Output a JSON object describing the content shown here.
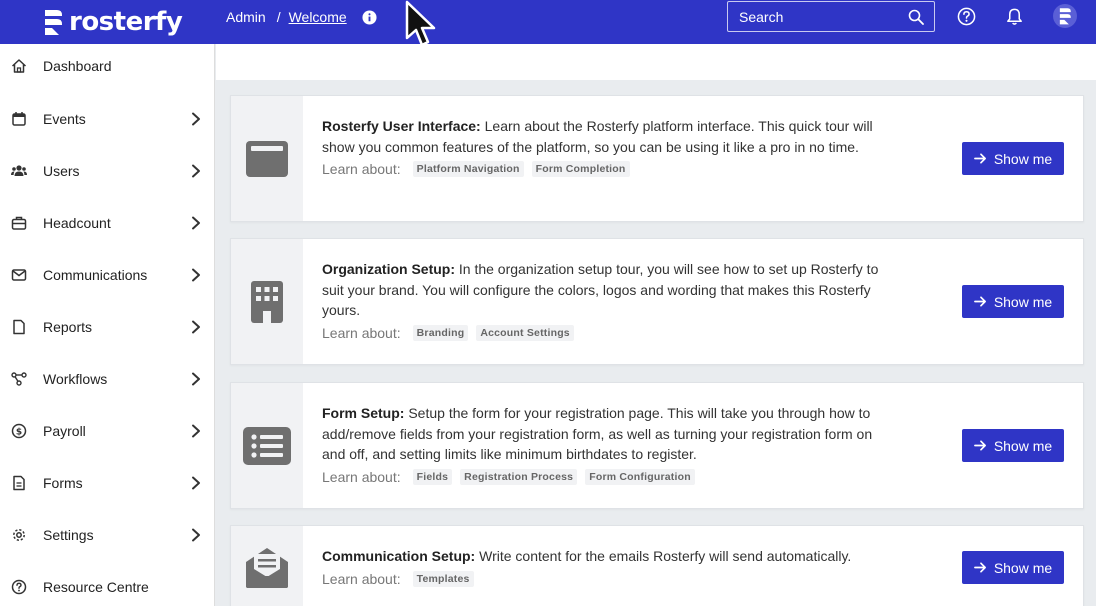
{
  "brand": {
    "name": "rosterfy",
    "accent": "#2f35c6"
  },
  "breadcrumb": {
    "root": "Admin",
    "separator": "/",
    "current": "Welcome"
  },
  "search": {
    "placeholder": "Search"
  },
  "topbar_icons": [
    "help-icon",
    "bell-icon",
    "avatar"
  ],
  "sidebar": {
    "items": [
      {
        "label": "Dashboard",
        "icon": "home-icon",
        "has_children": false
      },
      {
        "label": "Events",
        "icon": "calendar-icon",
        "has_children": true
      },
      {
        "label": "Users",
        "icon": "users-icon",
        "has_children": true
      },
      {
        "label": "Headcount",
        "icon": "briefcase-icon",
        "has_children": true
      },
      {
        "label": "Communications",
        "icon": "mail-icon",
        "has_children": true
      },
      {
        "label": "Reports",
        "icon": "file-icon",
        "has_children": true
      },
      {
        "label": "Workflows",
        "icon": "workflow-icon",
        "has_children": true
      },
      {
        "label": "Payroll",
        "icon": "dollar-icon",
        "has_children": true
      },
      {
        "label": "Forms",
        "icon": "form-icon",
        "has_children": true
      },
      {
        "label": "Settings",
        "icon": "gear-icon",
        "has_children": true
      },
      {
        "label": "Resource Centre",
        "icon": "question-icon",
        "has_children": false
      }
    ]
  },
  "tours": [
    {
      "title": "Rosterfy User Interface:",
      "description": " Learn about the Rosterfy platform interface. This quick tour will show you common features of the platform, so you can be using it like a pro in no time.",
      "icon": "window-icon",
      "learn_label": "Learn about:",
      "tags": [
        "Platform Navigation",
        "Form Completion"
      ],
      "button": "Show me"
    },
    {
      "title": "Organization Setup:",
      "description": " In the organization setup tour, you will see how to set up Rosterfy to suit your brand. You will configure the colors, logos and wording that makes this Rosterfy yours.",
      "icon": "building-icon",
      "learn_label": "Learn about:",
      "tags": [
        "Branding",
        "Account Settings"
      ],
      "button": "Show me"
    },
    {
      "title": "Form Setup:",
      "description": " Setup the form for your registration page. This will take you through how to add/remove fields from your registration form, as well as turning your registration form on and off, and setting limits like minimum birthdates to register.",
      "icon": "list-icon",
      "learn_label": "Learn about:",
      "tags": [
        "Fields",
        "Registration Process",
        "Form Configuration"
      ],
      "button": "Show me"
    },
    {
      "title": "Communication Setup:",
      "description": " Write content for the emails Rosterfy will send automatically.",
      "icon": "envelope-open-icon",
      "learn_label": "Learn about:",
      "tags": [
        "Templates"
      ],
      "button": "Show me"
    }
  ]
}
